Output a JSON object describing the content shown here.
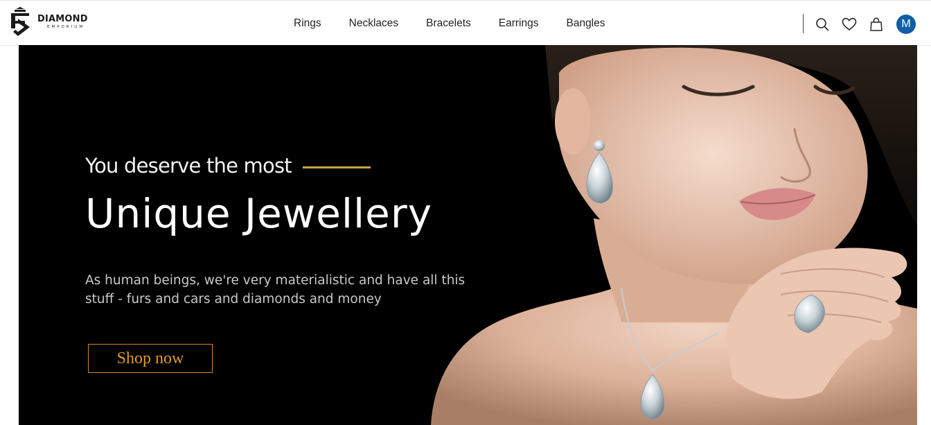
{
  "brand": {
    "name": "DIAMOND",
    "sub": "EMPORIUM"
  },
  "nav": {
    "items": [
      "Rings",
      "Necklaces",
      "Bracelets",
      "Earrings",
      "Bangles"
    ]
  },
  "header_icons": [
    "search-icon",
    "heart-icon",
    "shopping-bag-icon"
  ],
  "user": {
    "avatar_letter": "M",
    "avatar_color": "#0f5fa8"
  },
  "hero": {
    "tagline": "You deserve the most",
    "headline": "Unique Jewellery",
    "description": "As human beings, we're very materialistic and have all this stuff - furs and cars and diamonds and money",
    "cta_label": "Shop now",
    "accent_color": "#c7a24a",
    "cta_color": "#e39a24",
    "background_color": "#000000"
  }
}
